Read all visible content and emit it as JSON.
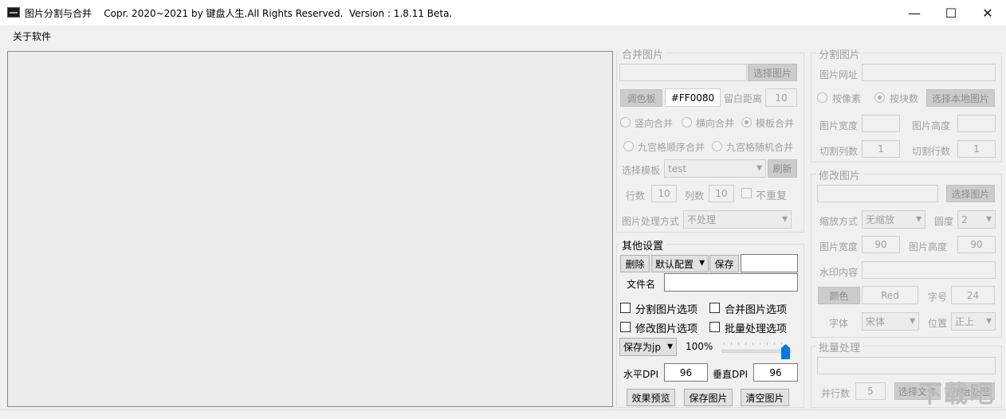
{
  "window": {
    "title": "图片分割与合并    Copr. 2020~2021 by 键盘人生.All Rights Reserved.  Version : 1.8.11 Beta.",
    "minimize_glyph": "—",
    "maximize_glyph": "☐",
    "close_glyph": "✕"
  },
  "menu": {
    "about": "关于软件"
  },
  "merge": {
    "legend": "合并图片",
    "path_value": "",
    "select_btn": "选择图片",
    "palette_btn": "调色板",
    "color_value": "#FF0080",
    "gap_label": "留白距离",
    "gap_value": "10",
    "radio_vertical": "竖向合并",
    "radio_horizontal": "横向合并",
    "radio_template": "模板合并",
    "radio_grid_seq": "九宫格顺序合并",
    "radio_grid_rand": "九宫格随机合并",
    "template_label": "选择模板",
    "template_value": "test",
    "refresh_btn": "刷新",
    "rows_label": "行数",
    "rows_value": "10",
    "cols_label": "列数",
    "cols_value": "10",
    "no_repeat": "不重复",
    "process_label": "图片处理方式",
    "process_value": "不处理"
  },
  "split": {
    "legend": "分割图片",
    "url_label": "图片网址",
    "url_value": "",
    "radio_pixel": "按像素",
    "radio_block": "按块数",
    "select_local_btn": "选择本地图片",
    "width_label": "图片宽度",
    "width_value": "",
    "height_label": "图片高度",
    "height_value": "",
    "cols_label": "切割列数",
    "cols_value": "1",
    "rows_label": "切割行数",
    "rows_value": "1"
  },
  "modify": {
    "legend": "修改图片",
    "path_value": "",
    "select_btn": "选择图片",
    "scale_label": "缩放方式",
    "scale_value": "无缩放",
    "rotate_label": "圆度",
    "rotate_value": "2",
    "width_label": "图片宽度",
    "width_value": "90",
    "height_label": "图片高度",
    "height_value": "90",
    "watermark_label": "水印内容",
    "watermark_value": "",
    "color_btn": "颜色",
    "color_value": "Red",
    "size_label": "字号",
    "size_value": "24",
    "font_label": "字体",
    "font_value": "宋体",
    "pos_label": "位置",
    "pos_value": "正上"
  },
  "batch": {
    "legend": "批量处理",
    "path_value": "",
    "parallel_label": "并行数",
    "parallel_value": "5",
    "select_btn": "选择文件",
    "start_btn": "开始处理"
  },
  "other": {
    "legend": "其他设置",
    "delete_btn": "删除",
    "config_value": "默认配置",
    "save_btn": "保存",
    "config_name_value": "",
    "filename_label": "文件名",
    "filename_value": "",
    "opt_split": "分割图片选项",
    "opt_merge": "合并图片选项",
    "opt_modify": "修改图片选项",
    "opt_batch": "批量处理选项",
    "format_value": "保存为jp",
    "quality_value": "100%",
    "quality_level": 1.0,
    "hdpi_label": "水平DPI",
    "hdpi_value": "96",
    "vdpi_label": "垂直DPI",
    "vdpi_value": "96",
    "preview_btn": "效果预览",
    "save_image_btn": "保存图片",
    "clear_btn": "清空图片"
  },
  "watermark_text": "下载吧",
  "colors": {
    "accent": "#0078d7",
    "disabled_text": "#a0a0a0"
  }
}
